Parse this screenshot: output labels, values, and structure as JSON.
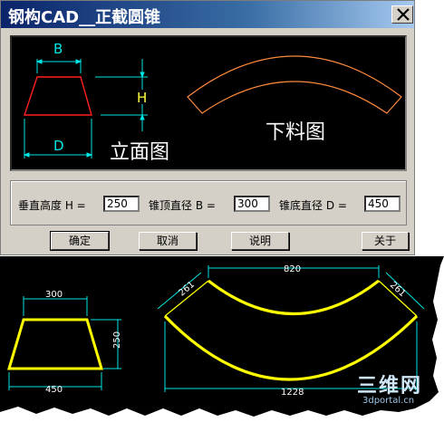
{
  "window": {
    "title": "钢构CAD__正截圆锥"
  },
  "preview": {
    "label_b": "B",
    "label_h": "H",
    "label_d": "D",
    "front_view": "立面图",
    "blank_view": "下料图",
    "colors": {
      "frustum": "#ff2020",
      "dims": "#00e5e5",
      "h_label": "#ffff40",
      "arc": "#ff8a3c"
    }
  },
  "fields": {
    "height": {
      "label": "垂直高度 H =",
      "value": "250"
    },
    "top_dia": {
      "label": "锥顶直径 B =",
      "value": "300"
    },
    "bottom_dia": {
      "label": "锥底直径 D =",
      "value": "450"
    }
  },
  "buttons": {
    "ok": "确定",
    "cancel": "取消",
    "help": "说明",
    "about": "关于"
  },
  "drawing": {
    "top_width": "300",
    "height": "250",
    "bottom_width": "450",
    "arc_chord": "820",
    "slant_left": "261",
    "slant_right": "261",
    "bottom_chord": "1228",
    "colors": {
      "shape": "#ffff00",
      "dims": "#00e5e5"
    }
  },
  "watermark": {
    "brand": "三维网",
    "url": "3dportal.cn"
  }
}
